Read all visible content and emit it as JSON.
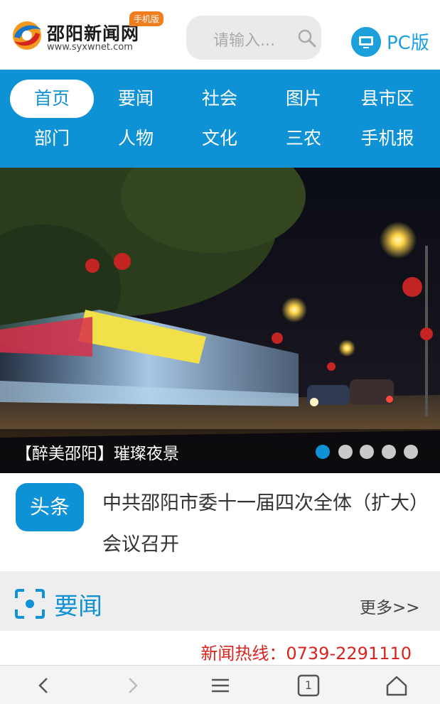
{
  "header": {
    "logo_title": "邵阳新闻网",
    "logo_url": "www.syxwnet.com",
    "mobile_badge": "手机版",
    "search_placeholder": "请输入...",
    "pc_label": "PC版"
  },
  "nav": {
    "items": [
      {
        "label": "首页",
        "active": true
      },
      {
        "label": "要闻"
      },
      {
        "label": "社会"
      },
      {
        "label": "图片"
      },
      {
        "label": "县市区"
      },
      {
        "label": "部门"
      },
      {
        "label": "人物"
      },
      {
        "label": "文化"
      },
      {
        "label": "三农"
      },
      {
        "label": "手机报"
      }
    ]
  },
  "banner": {
    "caption": "【醉美邵阳】璀璨夜景",
    "slide_count": 5,
    "active_slide": 1
  },
  "headline": {
    "badge": "头条",
    "text": "中共邵阳市委十一届四次全体（扩大）会议召开"
  },
  "section": {
    "title": "要闻",
    "more": "更多>>"
  },
  "hotline": "新闻热线：0739-2291110",
  "browser_bar": {
    "tab_count": "1"
  },
  "colors": {
    "brand_blue": "#0e92d5",
    "hotline_red": "#d8241f",
    "badge_orange": "#f07d1e"
  }
}
